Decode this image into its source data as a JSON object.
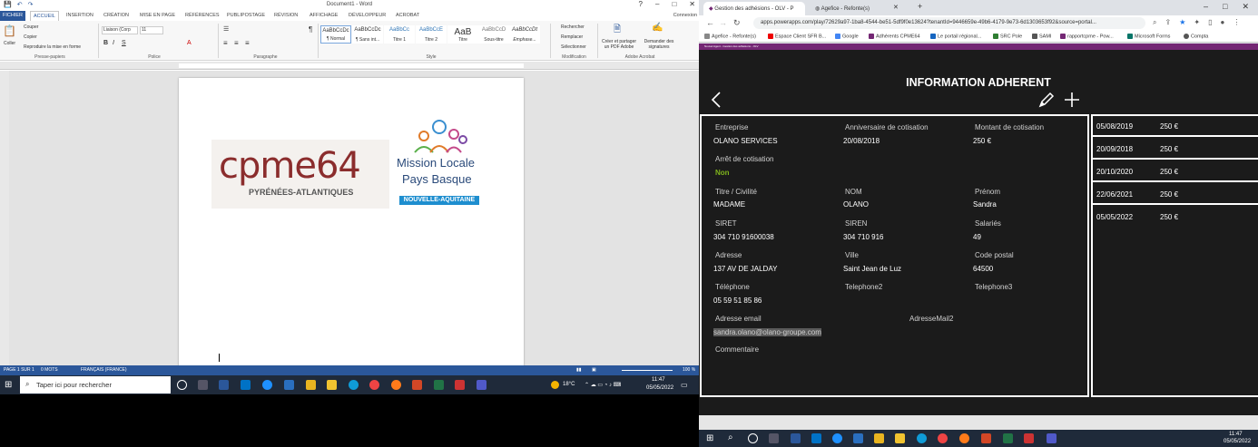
{
  "word": {
    "doc_title": "Document1 - Word",
    "tabs": [
      "FICHIER",
      "ACCUEIL",
      "INSERTION",
      "CRÉATION",
      "MISE EN PAGE",
      "RÉFÉRENCES",
      "PUBLIPOSTAGE",
      "RÉVISION",
      "AFFICHAGE",
      "DÉVELOPPEUR",
      "ACROBAT"
    ],
    "connexion": "Connexion",
    "clipboard": {
      "coller": "Coller",
      "couper": "Couper",
      "copier": "Copier",
      "reproduire": "Reproduire la mise en forme",
      "group": "Presse-papiers"
    },
    "font": {
      "name": "Liaison (Corp",
      "size": "11",
      "group": "Police"
    },
    "paragraph_group": "Paragraphe",
    "styles": [
      {
        "preview": "AaBbCcDc",
        "name": "¶ Normal"
      },
      {
        "preview": "AaBbCcDc",
        "name": "¶ Sans int..."
      },
      {
        "preview": "AaBbCc",
        "name": "Titre 1"
      },
      {
        "preview": "AaBbCcE",
        "name": "Titre 2"
      },
      {
        "preview": "AaB",
        "name": "Titre"
      },
      {
        "preview": "AaBbCcD",
        "name": "Sous-titre"
      },
      {
        "preview": "AaBbCcDt",
        "name": "Emphase..."
      }
    ],
    "style_group": "Style",
    "editing": {
      "rechercher": "Rechercher",
      "remplacer": "Remplacer",
      "selectionner": "Sélectionner",
      "group": "Modification"
    },
    "acrobat": {
      "create": "Créer et partager un PDF Adobe",
      "sign": "Demander des signatures",
      "group": "Adobe Acrobat"
    },
    "logo_left": {
      "text": "cpme64",
      "sub": "PYRÉNÉES-ATLANTIQUES"
    },
    "logo_right": {
      "l1": "Mission Locale",
      "l2": "Pays Basque",
      "l3": "NOUVELLE-AQUITAINE"
    },
    "status": {
      "page": "PAGE 1 SUR 1",
      "words": "0 MOTS",
      "lang": "FRANÇAIS (FRANCE)",
      "zoom": "100 %"
    }
  },
  "taskbar_left": {
    "search": "Taper ici pour rechercher",
    "temp": "18°C",
    "time": "11:47",
    "date": "05/05/2022"
  },
  "browser": {
    "tabs": [
      "Gestion des adhésions - OLV - P",
      "Agefice - Refonte(s)"
    ],
    "url": "apps.powerapps.com/play/72629a97-1ba8-4544-be51-5df9f0e13624?tenantId=9446659e-49b6-4179-9e73-6d1303653f92&source=portal...",
    "bookmarks": [
      "Agefice - Refonte(s)",
      "Espace Client SFR B...",
      "Google",
      "Adhérents CPME64",
      "Le portail régional...",
      "SRC Pole",
      "SAMI",
      "rapportcpme - Pow...",
      "Microsoft Forms",
      "Compta"
    ],
    "pa_banner": "Nouvel Agent - Gestion des adhésions - OLV",
    "colors": {
      "pa_bar": "#742774",
      "accent_green": "#7fb41c"
    }
  },
  "app": {
    "title": "INFORMATION ADHERENT",
    "fields": {
      "entreprise_l": "Entreprise",
      "entreprise_v": "OLANO SERVICES",
      "anniv_l": "Anniversaire de cotisation",
      "anniv_v": "20/08/2018",
      "montant_l": "Montant de cotisation",
      "montant_v": "250 €",
      "arret_l": "Arrêt de cotisation",
      "arret_v": "Non",
      "titre_l": "Titre / Civilité",
      "titre_v": "MADAME",
      "nom_l": "NOM",
      "nom_v": "OLANO",
      "prenom_l": "Prénom",
      "prenom_v": "Sandra",
      "siret_l": "SIRET",
      "siret_v": "304 710 91600038",
      "siren_l": "SIREN",
      "siren_v": "304 710 916",
      "salaries_l": "Salariés",
      "salaries_v": "49",
      "adresse_l": "Adresse",
      "adresse_v": "137 AV DE JALDAY",
      "ville_l": "Ville",
      "ville_v": "Saint Jean de Luz",
      "cp_l": "Code postal",
      "cp_v": "64500",
      "tel_l": "Téléphone",
      "tel_v": "05 59 51 85 86",
      "tel2_l": "Telephone2",
      "tel3_l": "Telephone3",
      "email_l": "Adresse email",
      "email_v": "sandra.olano@olano-groupe.com",
      "mail2_l": "AdresseMail2",
      "comment_l": "Commentaire"
    },
    "history": [
      {
        "date": "05/08/2019",
        "amount": "250 €"
      },
      {
        "date": "20/09/2018",
        "amount": "250 €"
      },
      {
        "date": "20/10/2020",
        "amount": "250 €"
      },
      {
        "date": "22/06/2021",
        "amount": "250 €"
      },
      {
        "date": "05/05/2022",
        "amount": "250 €"
      }
    ]
  },
  "taskbar_right": {
    "time": "11:47",
    "date": "05/05/2022"
  }
}
